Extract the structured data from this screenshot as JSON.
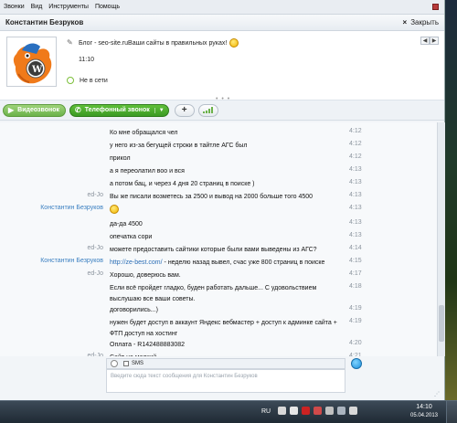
{
  "menu": {
    "items": [
      "Звонки",
      "Вид",
      "Инструменты",
      "Помощь"
    ]
  },
  "header": {
    "contact_name": "Константин Безруков",
    "close_label": "Закрыть"
  },
  "profile": {
    "mood": "Блог - seo-site.ruВаши сайты в правильных руках!",
    "local_time": "11:10",
    "status": "Не в сети"
  },
  "toolbar": {
    "video_label": "Видеозвонок",
    "call_label": "Телефонный звонок",
    "add_label": "+"
  },
  "messages": [
    {
      "sender": "",
      "text": "Ко мне обращался чел",
      "time": "4:12",
      "sender_type": "me"
    },
    {
      "sender": "",
      "text": "у него из-за бегущей строки в тайтле АГС был",
      "time": "4:12",
      "sender_type": "me"
    },
    {
      "sender": "",
      "text": "прикол",
      "time": "4:12",
      "sender_type": "me"
    },
    {
      "sender": "",
      "text": "а я переолатил воо и вся",
      "time": "4:13",
      "sender_type": "me"
    },
    {
      "sender": "",
      "text": "а потом бац, и через 4 дня 20 страниц в поиске )",
      "time": "4:13",
      "sender_type": "me"
    },
    {
      "sender": "ed-Jo",
      "text": "Вы же писали возметесь за 2500 и вывод на 2000 больше того 4500",
      "time": "4:13",
      "sender_type": "me"
    },
    {
      "sender": "Константин Безруков",
      "text": "",
      "time": "4:13",
      "sender_type": "contact",
      "smiley": true
    },
    {
      "sender": "",
      "text": "да-да 4500",
      "time": "4:13",
      "sender_type": "contact"
    },
    {
      "sender": "",
      "text": "опечатка сори",
      "time": "4:13",
      "sender_type": "contact"
    },
    {
      "sender": "ed-Jo",
      "text": "можете предоставить сайтики которые были вами выведены из АГС?",
      "time": "4:14",
      "sender_type": "me"
    },
    {
      "sender": "Константин Безруков",
      "text": "http://ze-best.com/",
      "text_rest": " - неделю назад вывел, счас уже 800 страниц в поиске",
      "time": "4:15",
      "sender_type": "contact",
      "link": true
    },
    {
      "sender": "ed-Jo",
      "text": "Хорошо, доверюсь вам.",
      "time": "4:17",
      "sender_type": "me"
    },
    {
      "sender": "",
      "text": "Если всё пройдет гладко, буден работать дальше... С удовольствием",
      "time": "4:18",
      "sender_type": "me"
    },
    {
      "sender": "",
      "text": "выслушаю все ваши советы.",
      "time": "",
      "sender_type": "me"
    },
    {
      "sender": "",
      "text": "договорились...)",
      "time": "4:19",
      "sender_type": "me"
    },
    {
      "sender": "",
      "text": "нужен будет доступ в аккаунт Яндекс вебмастер + доступ к админке сайта +",
      "time": "4:19",
      "sender_type": "contact"
    },
    {
      "sender": "",
      "text": "ФТП доступ на хостинг",
      "time": "",
      "sender_type": "contact"
    },
    {
      "sender": "",
      "text": "Оплата - R142488883082",
      "time": "4:20",
      "sender_type": "contact"
    },
    {
      "sender": "ed-Jo",
      "text": "Сайт не мелкий",
      "time": "4:21",
      "sender_type": "me"
    }
  ],
  "compose": {
    "sms_label": "SMS",
    "placeholder": "Введите сюда текст сообщения для Константин Безруков"
  },
  "taskbar": {
    "lang": "RU",
    "time": "14:10",
    "date": "05.04.2013"
  },
  "colors": {
    "contact_name": "#3a7fc1",
    "green_button": "#3b9a24",
    "status_green": "#7cbf3a"
  }
}
